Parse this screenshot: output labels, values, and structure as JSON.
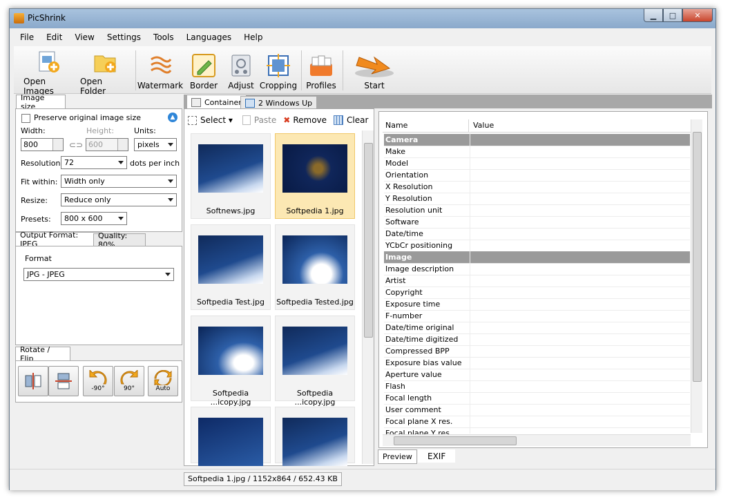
{
  "window": {
    "title": "PicShrink"
  },
  "menu": [
    "File",
    "Edit",
    "View",
    "Settings",
    "Tools",
    "Languages",
    "Help"
  ],
  "toolbar": {
    "open_images": "Open Images",
    "open_folder": "Open Folder",
    "watermark": "Watermark",
    "border": "Border",
    "adjust": "Adjust",
    "cropping": "Cropping",
    "profiles": "Profiles",
    "start": "Start"
  },
  "image_size": {
    "tab": "Image size",
    "preserve_label": "Preserve original image size",
    "width_label": "Width:",
    "width_value": "800",
    "height_label": "Height:",
    "height_value": "600",
    "units_label": "Units:",
    "units_value": "pixels",
    "resolution_label": "Resolution:",
    "resolution_value": "72",
    "resolution_unit": "dots per inch",
    "fit_label": "Fit within:",
    "fit_value": "Width only",
    "resize_label": "Resize:",
    "resize_value": "Reduce only",
    "presets_label": "Presets:",
    "presets_value": "800 x 600"
  },
  "output": {
    "tab_format": "Output Format: JPEG",
    "tab_quality": "Quality: 80%",
    "format_label": "Format",
    "format_value": "JPG - JPEG"
  },
  "rotate": {
    "tab": "Rotate / Flip",
    "minus90": "-90°",
    "plus90": "90°",
    "auto": "Auto"
  },
  "center_tabs": {
    "container": "Container",
    "windows_up": "2 Windows Up"
  },
  "actions": {
    "select": "Select",
    "paste": "Paste",
    "remove": "Remove",
    "clear": "Clear"
  },
  "thumbnails": [
    "Softnews.jpg",
    "Softpedia 1.jpg",
    "Softpedia Test.jpg",
    "Softpedia Tested.jpg",
    "Softpedia ...icopy.jpg",
    "Softpedia ...icopy.jpg"
  ],
  "exif": {
    "header_name": "Name",
    "header_value": "Value",
    "groups": {
      "camera": "Camera",
      "camera_items": [
        "Make",
        "Model",
        "Orientation",
        "X Resolution",
        "Y Resolution",
        "Resolution unit",
        "Software",
        "Date/time",
        "YCbCr positioning"
      ],
      "image": "Image",
      "image_items": [
        "Image description",
        "Artist",
        "Copyright",
        "Exposure time",
        "F-number",
        "Date/time original",
        "Date/time digitized",
        "Compressed BPP",
        "Exposure bias value",
        "Aperture value",
        "Flash",
        "Focal length",
        "User comment",
        "Focal plane X res.",
        "Focal plane Y res."
      ]
    },
    "tab_preview": "Preview",
    "tab_exif": "EXIF"
  },
  "status": {
    "text": "Softpedia 1.jpg / 1152x864 / 652.43 KB"
  }
}
